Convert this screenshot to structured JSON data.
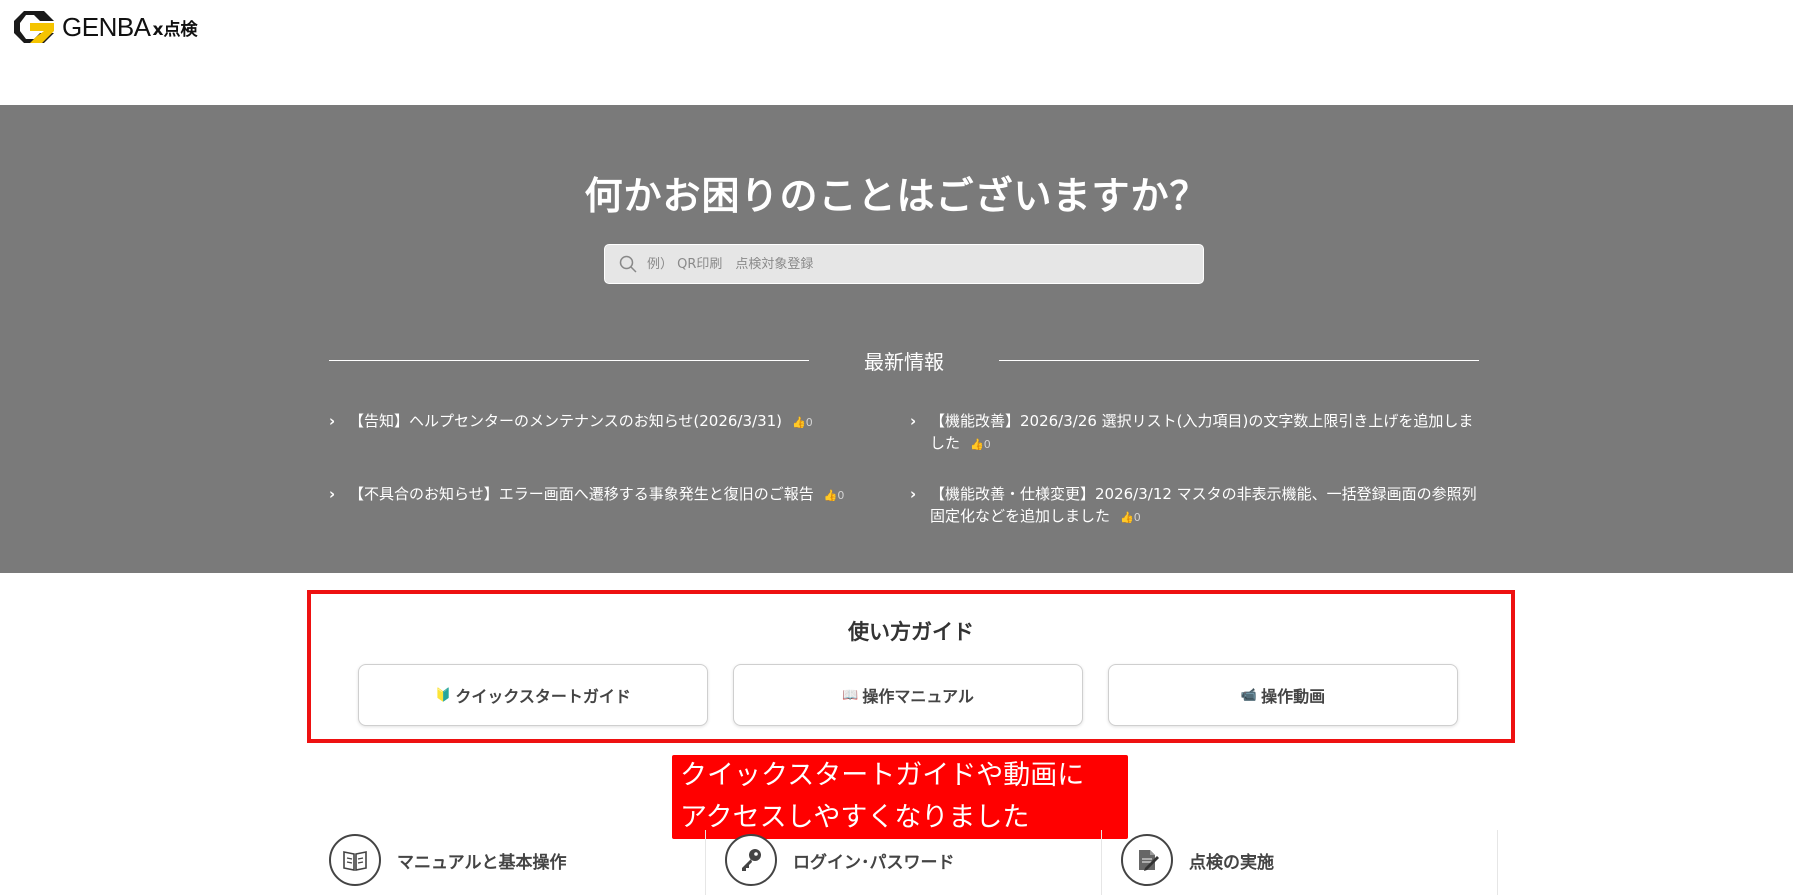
{
  "header": {
    "logo_text": "GENBA",
    "logo_sub": "x点検",
    "logo_icon": "genba-logo-icon",
    "logo_colors": {
      "dark": "#1a1a1a",
      "accent": "#f5c400"
    }
  },
  "hero": {
    "title": "何かお困りのことはございますか？",
    "background": "#7a7a7a",
    "search": {
      "placeholder": "例） QR印刷　点検対象登録",
      "icon": "search-icon"
    }
  },
  "news": {
    "heading": "最新情報",
    "items": [
      {
        "title": "【告知】ヘルプセンターのメンテナンスのお知らせ(2026/3/31)",
        "likes": "0"
      },
      {
        "title": "【機能改善】2026/3/26 選択リスト(入力項目)の文字数上限引き上げを追加しました",
        "likes": "0"
      },
      {
        "title": "【不具合のお知らせ】エラー画面へ遷移する事象発生と復旧のご報告",
        "likes": "0"
      },
      {
        "title": "【機能改善・仕様変更】2026/3/12 マスタの非表示機能、一括登録画面の参照列固定化などを追加しました",
        "likes": "0"
      }
    ]
  },
  "guide": {
    "title": "使い方ガイド",
    "border_color": "#ee1111",
    "buttons": [
      {
        "icon": "🔰",
        "icon_name": "beginner-mark-icon",
        "label": "クイックスタートガイド"
      },
      {
        "icon": "📖",
        "icon_name": "open-book-icon",
        "label": "操作マニュアル"
      },
      {
        "icon": "📹",
        "icon_name": "video-camera-icon",
        "label": "操作動画"
      }
    ]
  },
  "callout": {
    "line1": "クイックスタートガイドや動画に",
    "line2": "アクセスしやすくなりました",
    "color": "#ff0000"
  },
  "categories": [
    {
      "label": "マニュアルと基本操作",
      "icon": "manual-book-icon"
    },
    {
      "label": "ログイン･パスワード",
      "icon": "key-icon"
    },
    {
      "label": "点検の実施",
      "icon": "inspection-document-icon"
    }
  ]
}
